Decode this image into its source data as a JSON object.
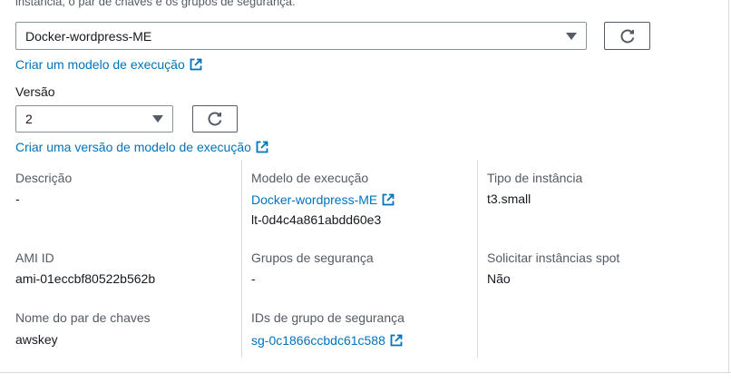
{
  "intro_text": "instância, o par de chaves e os grupos de segurança.",
  "template_select": {
    "value": "Docker-wordpress-ME"
  },
  "create_template_link": "Criar um modelo de execução",
  "version": {
    "label": "Versão",
    "value": "2"
  },
  "create_version_link": "Criar uma versão de modelo de execução",
  "details": {
    "description": {
      "label": "Descrição",
      "value": "-"
    },
    "launch_template": {
      "label": "Modelo de execução",
      "link": "Docker-wordpress-ME",
      "id": "lt-0d4c4a861abdd60e3"
    },
    "instance_type": {
      "label": "Tipo de instância",
      "value": "t3.small"
    },
    "ami": {
      "label": "AMI ID",
      "value": "ami-01eccbf80522b562b"
    },
    "security_groups": {
      "label": "Grupos de segurança",
      "value": "-"
    },
    "spot": {
      "label": "Solicitar instâncias spot",
      "value": "Não"
    },
    "key_pair": {
      "label": "Nome do par de chaves",
      "value": "awskey"
    },
    "sg_ids": {
      "label": "IDs de grupo de segurança",
      "link": "sg-0c1866ccbdc61c588"
    }
  },
  "icons": {
    "external": "external-link-icon",
    "refresh": "refresh-icon",
    "dropdown": "caret-down-icon"
  },
  "colors": {
    "link": "#0073bb",
    "label": "#545b64",
    "text": "#16191f",
    "border": "#879596"
  }
}
